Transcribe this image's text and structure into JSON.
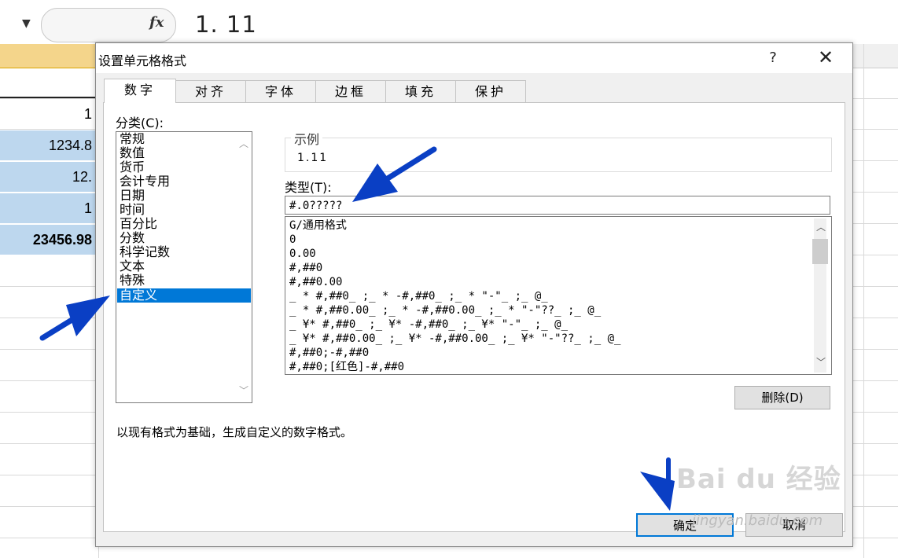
{
  "formula_bar": {
    "fx_label": "fx",
    "value": "1. 11"
  },
  "sheet": {
    "cells": [
      "1",
      "1234.8",
      "12.",
      "1",
      "23456.98"
    ]
  },
  "dialog": {
    "title": "设置单元格格式",
    "help": "?",
    "close": "✕",
    "tabs": [
      "数字",
      "对齐",
      "字体",
      "边框",
      "填充",
      "保护"
    ],
    "active_tab": "数字",
    "category_label": "分类(C):",
    "categories": [
      "常规",
      "数值",
      "货币",
      "会计专用",
      "日期",
      "时间",
      "百分比",
      "分数",
      "科学记数",
      "文本",
      "特殊",
      "自定义"
    ],
    "selected_category": "自定义",
    "sample_label": "示例",
    "sample_value": "1.11",
    "type_label": "类型(T):",
    "type_value": "#.0?????",
    "formats": [
      "G/通用格式",
      "0",
      "0.00",
      "#,##0",
      "#,##0.00",
      "_ * #,##0_ ;_ * -#,##0_ ;_ * \"-\"_ ;_ @_",
      "_ * #,##0.00_ ;_ * -#,##0.00_ ;_ * \"-\"??_ ;_ @_",
      "_ ¥* #,##0_ ;_ ¥* -#,##0_ ;_ ¥* \"-\"_ ;_ @_",
      "_ ¥* #,##0.00_ ;_ ¥* -#,##0.00_ ;_ ¥* \"-\"??_ ;_ @_",
      "#,##0;-#,##0",
      "#,##0;[红色]-#,##0"
    ],
    "delete_label": "删除(D)",
    "description": "以现有格式为基础，生成自定义的数字格式。",
    "ok_label": "确定",
    "cancel_label": "取消"
  },
  "watermark": {
    "brand": "Bai du 经验",
    "url": "jingyan.baidu.com"
  },
  "colors": {
    "selection": "#0078d7",
    "cell_fill": "#bdd7ee",
    "annotation_arrow": "#0a3fc4"
  }
}
